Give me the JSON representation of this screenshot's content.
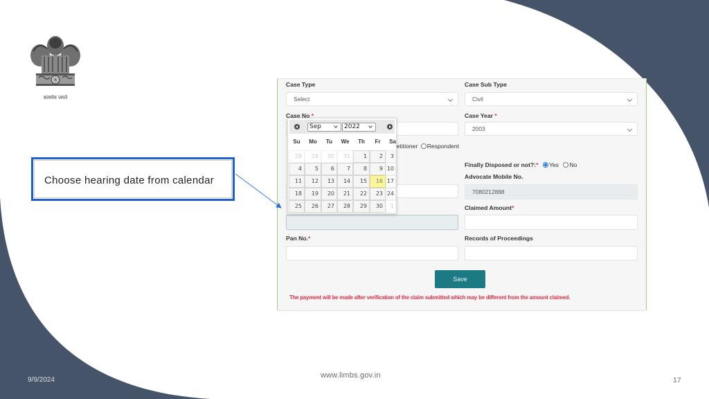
{
  "slide": {
    "date": "9/9/2024",
    "footer_url": "www.limbs.gov.in",
    "page_number": "17"
  },
  "emblem": {
    "motto": "सत्यमेव जयते"
  },
  "callout": {
    "text": "Choose hearing date from calendar"
  },
  "form": {
    "case_type": {
      "label": "Case Type",
      "value": "Select"
    },
    "case_sub_type": {
      "label": "Case Sub Type",
      "value": "Civil"
    },
    "case_no": {
      "label": "Case No",
      "required": "*",
      "value": ""
    },
    "case_year": {
      "label": "Case Year",
      "required": "*",
      "value": "2003"
    },
    "party": {
      "options": [
        "Petitioner",
        "Respondent"
      ]
    },
    "finally_disposed": {
      "label": "Finally Disposed or not?:",
      "required": "*",
      "options": [
        {
          "label": "Yes",
          "checked": true
        },
        {
          "label": "No",
          "checked": false
        }
      ]
    },
    "advocate_mobile": {
      "label": "Advocate Mobile No.",
      "value": "7080212888"
    },
    "claimed_amount": {
      "label": "Claimed Amount",
      "required": "*",
      "value": ""
    },
    "hearing_date": {
      "value": ""
    },
    "pan_no": {
      "label": "Pan No.",
      "required": "*",
      "value": ""
    },
    "records": {
      "label": "Records of Proceedings",
      "value": ""
    },
    "save_label": "Save",
    "notice": "The payment will be made after verification of the claim submitted which may be different from the amount claimed."
  },
  "datepicker": {
    "month": "Sep",
    "year": "2022",
    "weekdays": [
      "Su",
      "Mo",
      "Tu",
      "We",
      "Th",
      "Fr",
      "Sa"
    ],
    "weeks": [
      [
        "28",
        "29",
        "30",
        "31",
        "1",
        "2",
        "3"
      ],
      [
        "4",
        "5",
        "6",
        "7",
        "8",
        "9",
        "10"
      ],
      [
        "11",
        "12",
        "13",
        "14",
        "15",
        "16",
        "17"
      ],
      [
        "18",
        "19",
        "20",
        "21",
        "22",
        "23",
        "24"
      ],
      [
        "25",
        "26",
        "27",
        "28",
        "29",
        "30",
        "1"
      ]
    ],
    "outside_month": [
      [
        0,
        0
      ],
      [
        0,
        1
      ],
      [
        0,
        2
      ],
      [
        0,
        3
      ],
      [
        4,
        6
      ]
    ],
    "highlighted": [
      2,
      5
    ]
  },
  "colors": {
    "background_shape": "#465469",
    "callout_border": "#1c5fcf",
    "save_button": "#1b7a83",
    "notice_text": "#d6334a",
    "required_marker": "#d9344a",
    "highlight_day": "#fbf59c",
    "panel_border": "#9bcf83"
  }
}
